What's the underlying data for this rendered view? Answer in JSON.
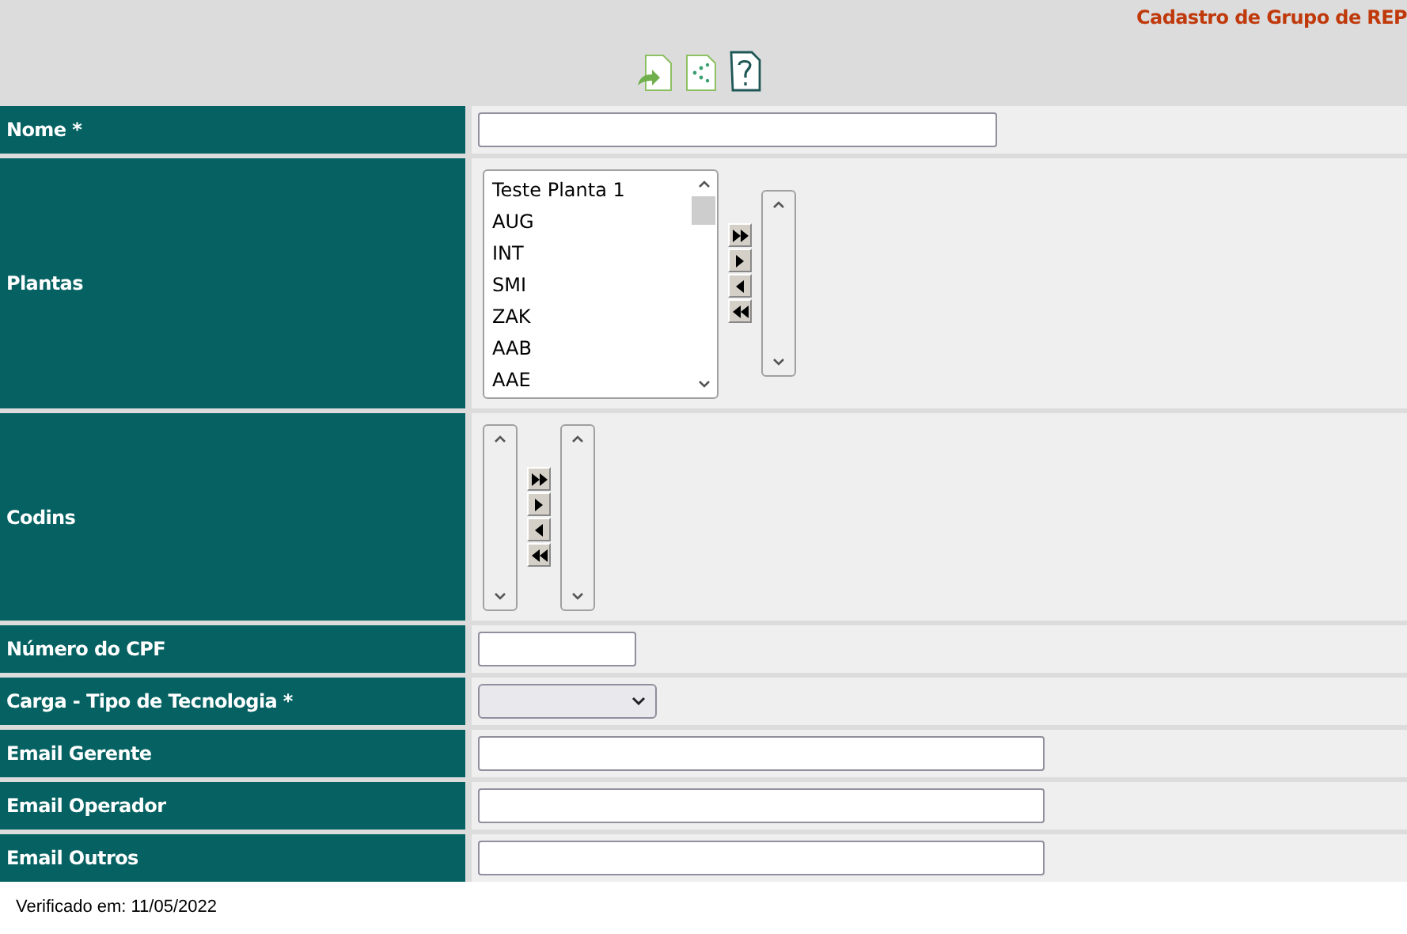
{
  "header": {
    "title": "Cadastro de Grupo de REP"
  },
  "rows": [
    {
      "label": "Nome *",
      "kind": "text"
    },
    {
      "label": "Plantas",
      "kind": "dual_list",
      "options": [
        "Teste Planta 1",
        "AUG",
        "INT",
        "SMI",
        "ZAK",
        "AAB",
        "AAE"
      ]
    },
    {
      "label": "Codins",
      "kind": "dual_list",
      "options": []
    },
    {
      "label": "Número do CPF",
      "kind": "number"
    },
    {
      "label": "Carga - Tipo de Tecnologia *",
      "kind": "select"
    },
    {
      "label": "Email Gerente",
      "kind": "email"
    },
    {
      "label": "Email Operador",
      "kind": "email"
    },
    {
      "label": "Email Outros",
      "kind": "email"
    }
  ],
  "footer": "Verificado em: 11/05/2022"
}
